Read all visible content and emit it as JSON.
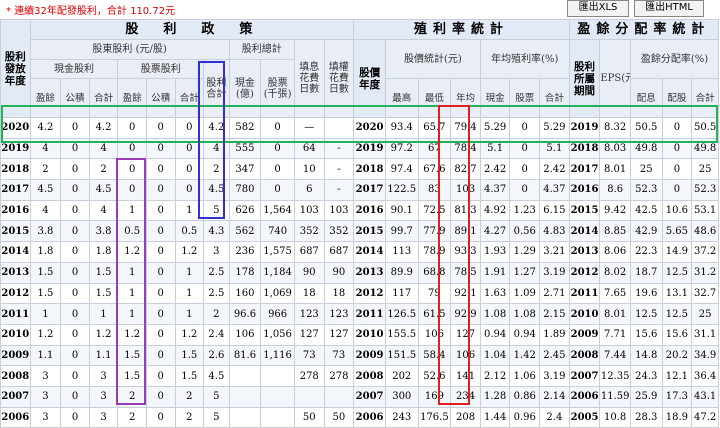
{
  "notice": "* 連續32年配發股利，合計 110.72元",
  "buttons": {
    "xls": "匯出XLS",
    "html": "匯出HTML"
  },
  "headers": {
    "policy": "股　利　政　策",
    "yield_stats": "殖利率統計",
    "payout_stats": "盈餘分配率統計",
    "year": "股利發放年度",
    "shareholder_dividend": "股東股利 (元/股)",
    "cash_dividend": "現金股利",
    "stock_dividend": "股票股利",
    "dividend_total": "股利總計",
    "cash_dividend_total": "股利合計",
    "cash": "現金(億)",
    "stock": "股票(千張)",
    "fill_div_days": "填息花費日數",
    "fill_right_days": "填權花費日數",
    "price_year": "股價年度",
    "price_stats": "股價統計(元)",
    "avg_yield": "年均殖利率(%)",
    "earnings_year": "股利所屬期間",
    "eps": "EPS(元)",
    "payout_ratio": "盈餘分配率(%)",
    "sub": {
      "earnings": "盈餘",
      "reserve": "公積",
      "total": "合計",
      "high": "最高",
      "low": "最低",
      "avg": "年均",
      "cash": "現金",
      "stock": "股票",
      "alloc_cash": "配息",
      "alloc_stock": "配股"
    }
  },
  "rows": [
    [
      "2020",
      "4.2",
      "0",
      "4.2",
      "0",
      "0",
      "0",
      "4.2",
      "582",
      "0",
      "—",
      "",
      "2020",
      "93.4",
      "65.7",
      "79.4",
      "5.29",
      "0",
      "5.29",
      "2019",
      "8.32",
      "50.5",
      "0",
      "50.5"
    ],
    [
      "2019",
      "4",
      "0",
      "4",
      "0",
      "0",
      "0",
      "4",
      "555",
      "0",
      "64",
      "-",
      "2019",
      "97.2",
      "67",
      "78.4",
      "5.1",
      "0",
      "5.1",
      "2018",
      "8.03",
      "49.8",
      "0",
      "49.8"
    ],
    [
      "2018",
      "2",
      "0",
      "2",
      "0",
      "0",
      "0",
      "2",
      "347",
      "0",
      "10",
      "-",
      "2018",
      "97.4",
      "67.6",
      "82.7",
      "2.42",
      "0",
      "2.42",
      "2017",
      "8.01",
      "25",
      "0",
      "25"
    ],
    [
      "2017",
      "4.5",
      "0",
      "4.5",
      "0",
      "0",
      "0",
      "4.5",
      "780",
      "0",
      "6",
      "-",
      "2017",
      "122.5",
      "83",
      "103",
      "4.37",
      "0",
      "4.37",
      "2016",
      "8.6",
      "52.3",
      "0",
      "52.3"
    ],
    [
      "2016",
      "4",
      "0",
      "4",
      "1",
      "0",
      "1",
      "5",
      "626",
      "1,564",
      "103",
      "103",
      "2016",
      "90.1",
      "72.5",
      "81.3",
      "4.92",
      "1.23",
      "6.15",
      "2015",
      "9.42",
      "42.5",
      "10.6",
      "53.1"
    ],
    [
      "2015",
      "3.8",
      "0",
      "3.8",
      "0.5",
      "0",
      "0.5",
      "4.3",
      "562",
      "740",
      "352",
      "352",
      "2015",
      "99.7",
      "77.9",
      "89.1",
      "4.27",
      "0.56",
      "4.83",
      "2014",
      "8.85",
      "42.9",
      "5.65",
      "48.6"
    ],
    [
      "2014",
      "1.8",
      "0",
      "1.8",
      "1.2",
      "0",
      "1.2",
      "3",
      "236",
      "1,575",
      "687",
      "687",
      "2014",
      "113",
      "78.9",
      "93.3",
      "1.93",
      "1.29",
      "3.21",
      "2013",
      "8.06",
      "22.3",
      "14.9",
      "37.2"
    ],
    [
      "2013",
      "1.5",
      "0",
      "1.5",
      "1",
      "0",
      "1",
      "2.5",
      "178",
      "1,184",
      "90",
      "90",
      "2013",
      "89.9",
      "68.8",
      "78.5",
      "1.91",
      "1.27",
      "3.19",
      "2012",
      "8.02",
      "18.7",
      "12.5",
      "31.2"
    ],
    [
      "2012",
      "1.5",
      "0",
      "1.5",
      "1",
      "0",
      "1",
      "2.5",
      "160",
      "1,069",
      "18",
      "18",
      "2012",
      "117",
      "79",
      "92.1",
      "1.63",
      "1.09",
      "2.71",
      "2011",
      "7.65",
      "19.6",
      "13.1",
      "32.7"
    ],
    [
      "2011",
      "1",
      "0",
      "1",
      "1",
      "0",
      "1",
      "2",
      "96.6",
      "966",
      "123",
      "123",
      "2011",
      "126.5",
      "61.5",
      "92.9",
      "1.08",
      "1.08",
      "2.15",
      "2010",
      "8.01",
      "12.5",
      "12.5",
      "25"
    ],
    [
      "2010",
      "1.2",
      "0",
      "1.2",
      "1.2",
      "0",
      "1.2",
      "2.4",
      "106",
      "1,056",
      "127",
      "127",
      "2010",
      "155.5",
      "106",
      "127",
      "0.94",
      "0.94",
      "1.89",
      "2009",
      "7.71",
      "15.6",
      "15.6",
      "31.1"
    ],
    [
      "2009",
      "1.1",
      "0",
      "1.1",
      "1.5",
      "0",
      "1.5",
      "2.6",
      "81.6",
      "1,116",
      "73",
      "73",
      "2009",
      "151.5",
      "58.4",
      "106",
      "1.04",
      "1.42",
      "2.45",
      "2008",
      "7.44",
      "14.8",
      "20.2",
      "34.9"
    ],
    [
      "2008",
      "3",
      "0",
      "3",
      "1.5",
      "0",
      "1.5",
      "4.5",
      "",
      "",
      "278",
      "278",
      "2008",
      "202",
      "52.6",
      "141",
      "2.12",
      "1.06",
      "3.19",
      "2007",
      "12.35",
      "24.3",
      "12.1",
      "36.4"
    ],
    [
      "2007",
      "3",
      "0",
      "3",
      "2",
      "0",
      "2",
      "5",
      "",
      "",
      "",
      "",
      "2007",
      "300",
      "169",
      "234",
      "1.28",
      "0.86",
      "2.14",
      "2006",
      "11.59",
      "25.9",
      "17.3",
      "43.1"
    ],
    [
      "2006",
      "3",
      "0",
      "3",
      "2",
      "0",
      "2",
      "5",
      "",
      "",
      "50",
      "50",
      "2006",
      "243",
      "176.5",
      "208",
      "1.44",
      "0.96",
      "2.4",
      "2005",
      "10.8",
      "28.3",
      "18.9",
      "47.2"
    ]
  ],
  "highlight_colors": {
    "green": "#1fb25a",
    "blue": "#3030d0",
    "purple": "#9a3cb8",
    "red": "#e02020"
  }
}
